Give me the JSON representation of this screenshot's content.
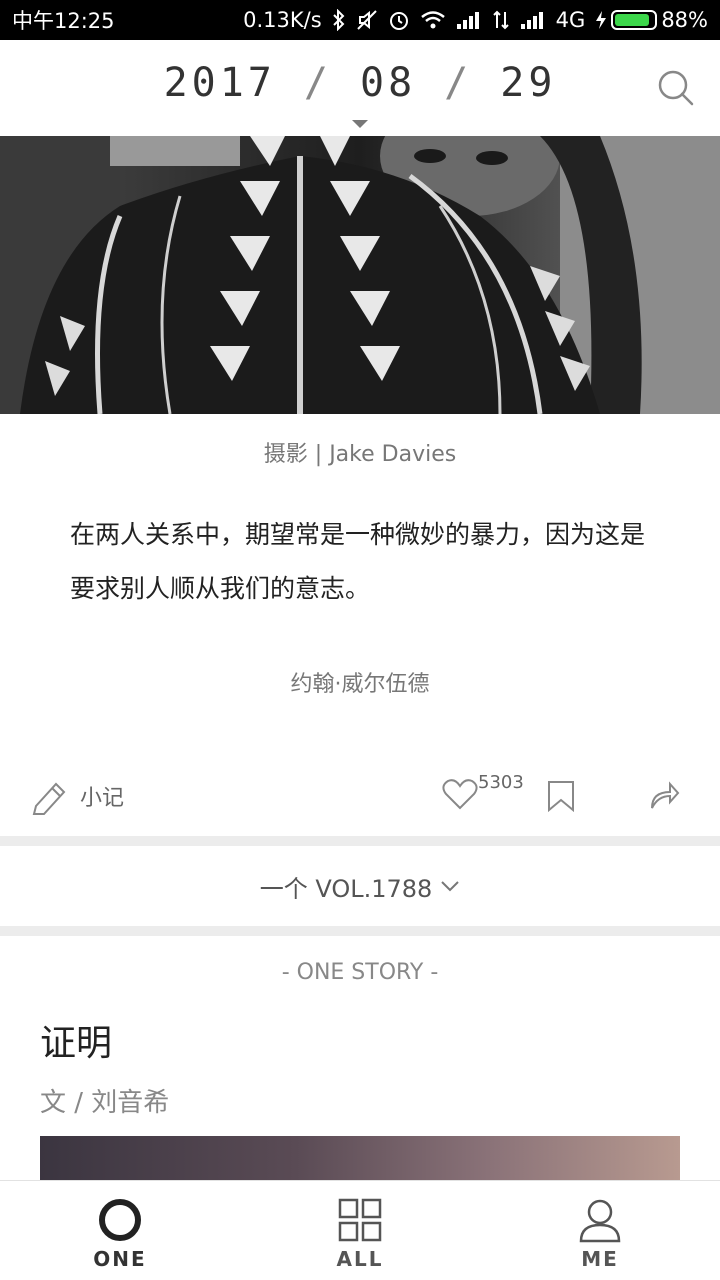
{
  "status_bar": {
    "time": "中午12:25",
    "speed": "0.13K/s",
    "network": "4G",
    "battery": "88%",
    "battery_level": 0.88,
    "icons": [
      "bluetooth-icon",
      "mute-icon",
      "alarm-icon",
      "wifi-icon",
      "signal-icon",
      "data-arrows-icon",
      "signal-icon",
      "charging-icon",
      "battery-icon"
    ]
  },
  "header": {
    "year": "2017",
    "month": "08",
    "day": "29",
    "separator": "/"
  },
  "card": {
    "photo_credit": "摄影 | Jake Davies",
    "quote": "在两人关系中，期望常是一种微妙的暴力，因为这是要求别人顺从我们的意志。",
    "author": "约翰·威尔伍德",
    "note_label": "小记",
    "like_count": "5303"
  },
  "volume": {
    "label": "一个 VOL.1788"
  },
  "story": {
    "tag": "- ONE STORY -",
    "title": "证明",
    "author": "文 / 刘音希"
  },
  "tabs": [
    {
      "label": "ONE"
    },
    {
      "label": "ALL"
    },
    {
      "label": "ME"
    }
  ]
}
